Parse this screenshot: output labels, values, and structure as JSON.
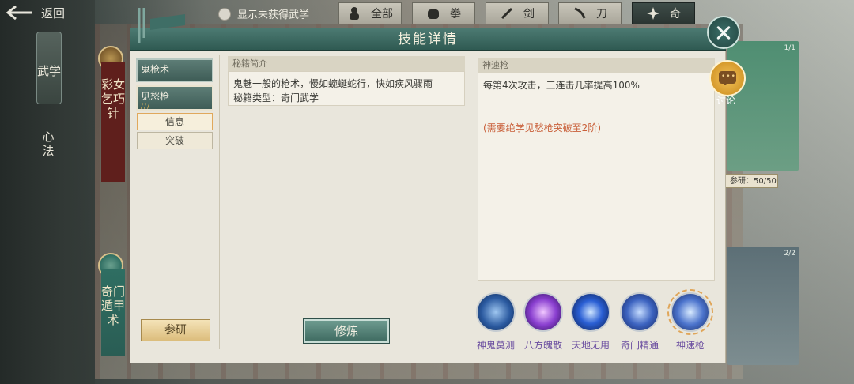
{
  "nav": {
    "back_label": "返回",
    "tab_martial": "武学",
    "tab_mental": "心法"
  },
  "filter": {
    "checkbox_label": "显示未获得武学",
    "buttons": [
      {
        "label": "全部",
        "icon": "person-icon"
      },
      {
        "label": "拳",
        "icon": "fist-icon"
      },
      {
        "label": "剑",
        "icon": "sword-icon"
      },
      {
        "label": "刀",
        "icon": "blade-icon"
      },
      {
        "label": "奇",
        "icon": "shuriken-icon"
      }
    ],
    "active_index": 4
  },
  "background": {
    "banner1": "彩女乞巧针",
    "banner2": "奇门遁甲术",
    "card1_pages": "1/1",
    "card2_pages": "2/2",
    "study_progress": "参研：50/50"
  },
  "modal": {
    "title": "技能详情",
    "skill_tabs": [
      {
        "label": "鬼枪术"
      },
      {
        "label": "见愁枪",
        "pips": "///"
      }
    ],
    "sub_buttons": [
      "信息",
      "突破"
    ],
    "study_button": "参研",
    "train_button": "修炼",
    "middle": {
      "title": "秘籍简介",
      "desc_line1": "鬼魅一般的枪术，慢如蜿蜒蛇行，快如疾风骤雨",
      "desc_line2": "秘籍类型：奇门武学"
    },
    "right": {
      "title": "神速枪",
      "effect": "每第4次攻击，三连击几率提高100%",
      "requirement": "(需要绝学见愁枪突破至2阶)"
    },
    "skills": [
      {
        "name": "神鬼莫测",
        "icon": "ghost-skill-icon"
      },
      {
        "name": "八方魄散",
        "icon": "purple-burst-icon"
      },
      {
        "name": "天地无用",
        "icon": "blue-sphere-icon"
      },
      {
        "name": "奇门精通",
        "icon": "qimen-icon"
      },
      {
        "name": "神速枪",
        "icon": "speed-spear-icon"
      }
    ],
    "chat_label": "讨论"
  }
}
